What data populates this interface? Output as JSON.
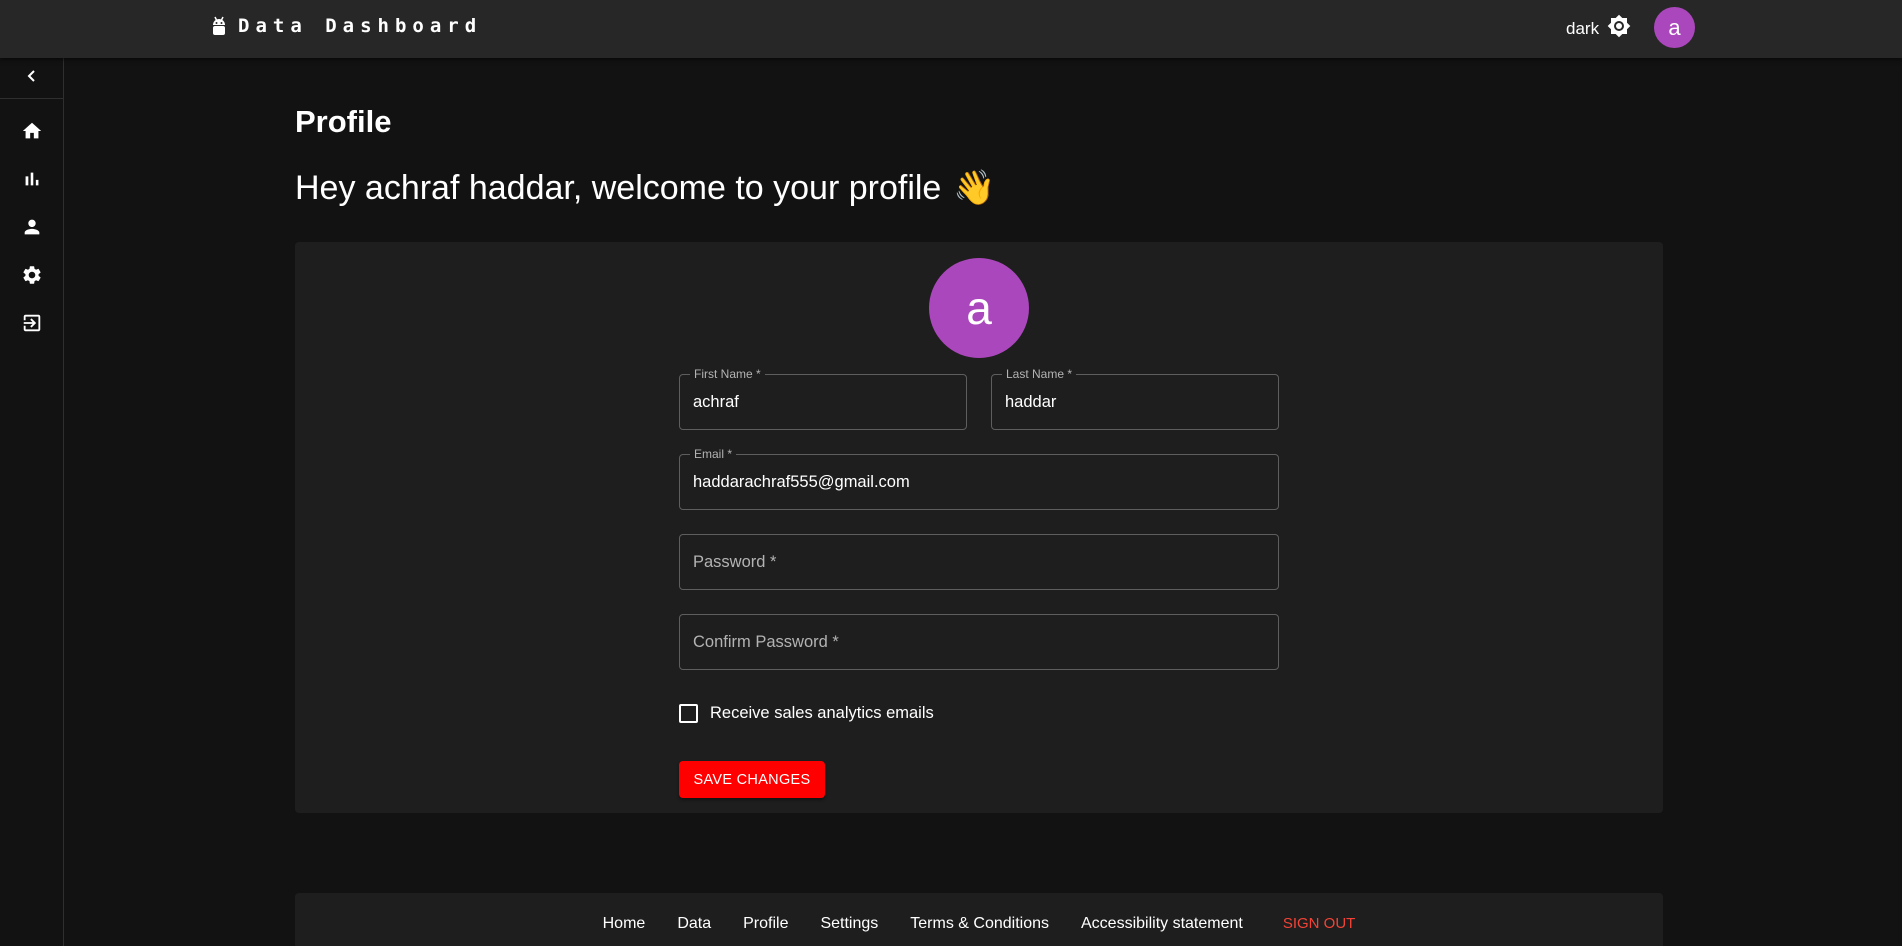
{
  "header": {
    "app_title": "Data Dashboard",
    "brand_icon": "android-icon",
    "theme_label": "dark",
    "theme_icon": "brightness-icon",
    "avatar_letter": "a",
    "avatar_color": "#ab47bc"
  },
  "sidebar": {
    "collapse_icon": "chevron-left-icon",
    "items": [
      {
        "icon": "home-icon"
      },
      {
        "icon": "bar-chart-icon"
      },
      {
        "icon": "person-icon"
      },
      {
        "icon": "gear-icon"
      },
      {
        "icon": "logout-icon"
      }
    ]
  },
  "main": {
    "title": "Profile",
    "welcome": "Hey achraf haddar, welcome to your profile",
    "welcome_emoji": "👋"
  },
  "form": {
    "avatar_letter": "a",
    "first_name": {
      "label": "First Name *",
      "value": "achraf"
    },
    "last_name": {
      "label": "Last Name *",
      "value": "haddar"
    },
    "email": {
      "label": "Email *",
      "value": "haddarachraf555@gmail.com"
    },
    "password": {
      "placeholder": "Password *"
    },
    "confirm_password": {
      "placeholder": "Confirm Password *"
    },
    "checkbox_label": "Receive sales analytics emails",
    "checkbox_checked": false,
    "save_label": "SAVE CHANGES"
  },
  "footer": {
    "links": [
      "Home",
      "Data",
      "Profile",
      "Settings",
      "Terms & Conditions",
      "Accessibility statement"
    ],
    "signout": "SIGN OUT"
  },
  "colors": {
    "accent": "#ff0000",
    "avatar": "#ab47bc",
    "signout": "#f44336"
  }
}
